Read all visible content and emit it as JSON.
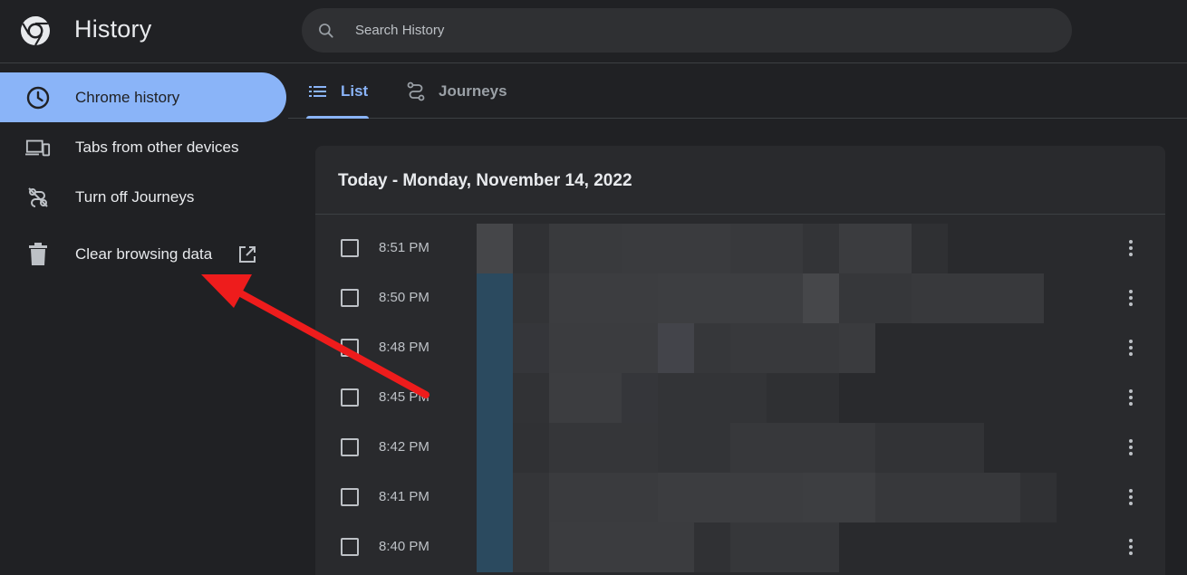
{
  "header": {
    "title": "History",
    "search_placeholder": "Search History"
  },
  "sidebar": {
    "items": [
      {
        "label": "Chrome history",
        "icon": "clock-icon",
        "active": true
      },
      {
        "label": "Tabs from other devices",
        "icon": "devices-icon",
        "active": false
      },
      {
        "label": "Turn off Journeys",
        "icon": "journeys-off-icon",
        "active": false
      },
      {
        "label": "Clear browsing data",
        "icon": "trash-icon",
        "active": false,
        "trailing_icon": "external-link-icon"
      }
    ]
  },
  "tabs": [
    {
      "label": "List",
      "icon": "list-icon",
      "active": true
    },
    {
      "label": "Journeys",
      "icon": "journeys-icon",
      "active": false
    }
  ],
  "history": {
    "date_heading": "Today - Monday, November 14, 2022",
    "entries": [
      {
        "time": "8:51 PM"
      },
      {
        "time": "8:50 PM"
      },
      {
        "time": "8:48 PM"
      },
      {
        "time": "8:45 PM"
      },
      {
        "time": "8:42 PM"
      },
      {
        "time": "8:41 PM"
      },
      {
        "time": "8:40 PM"
      }
    ]
  },
  "colors": {
    "background": "#202124",
    "card": "#292a2d",
    "accent": "#8ab4f8",
    "annotation": "#ee1c1c"
  }
}
